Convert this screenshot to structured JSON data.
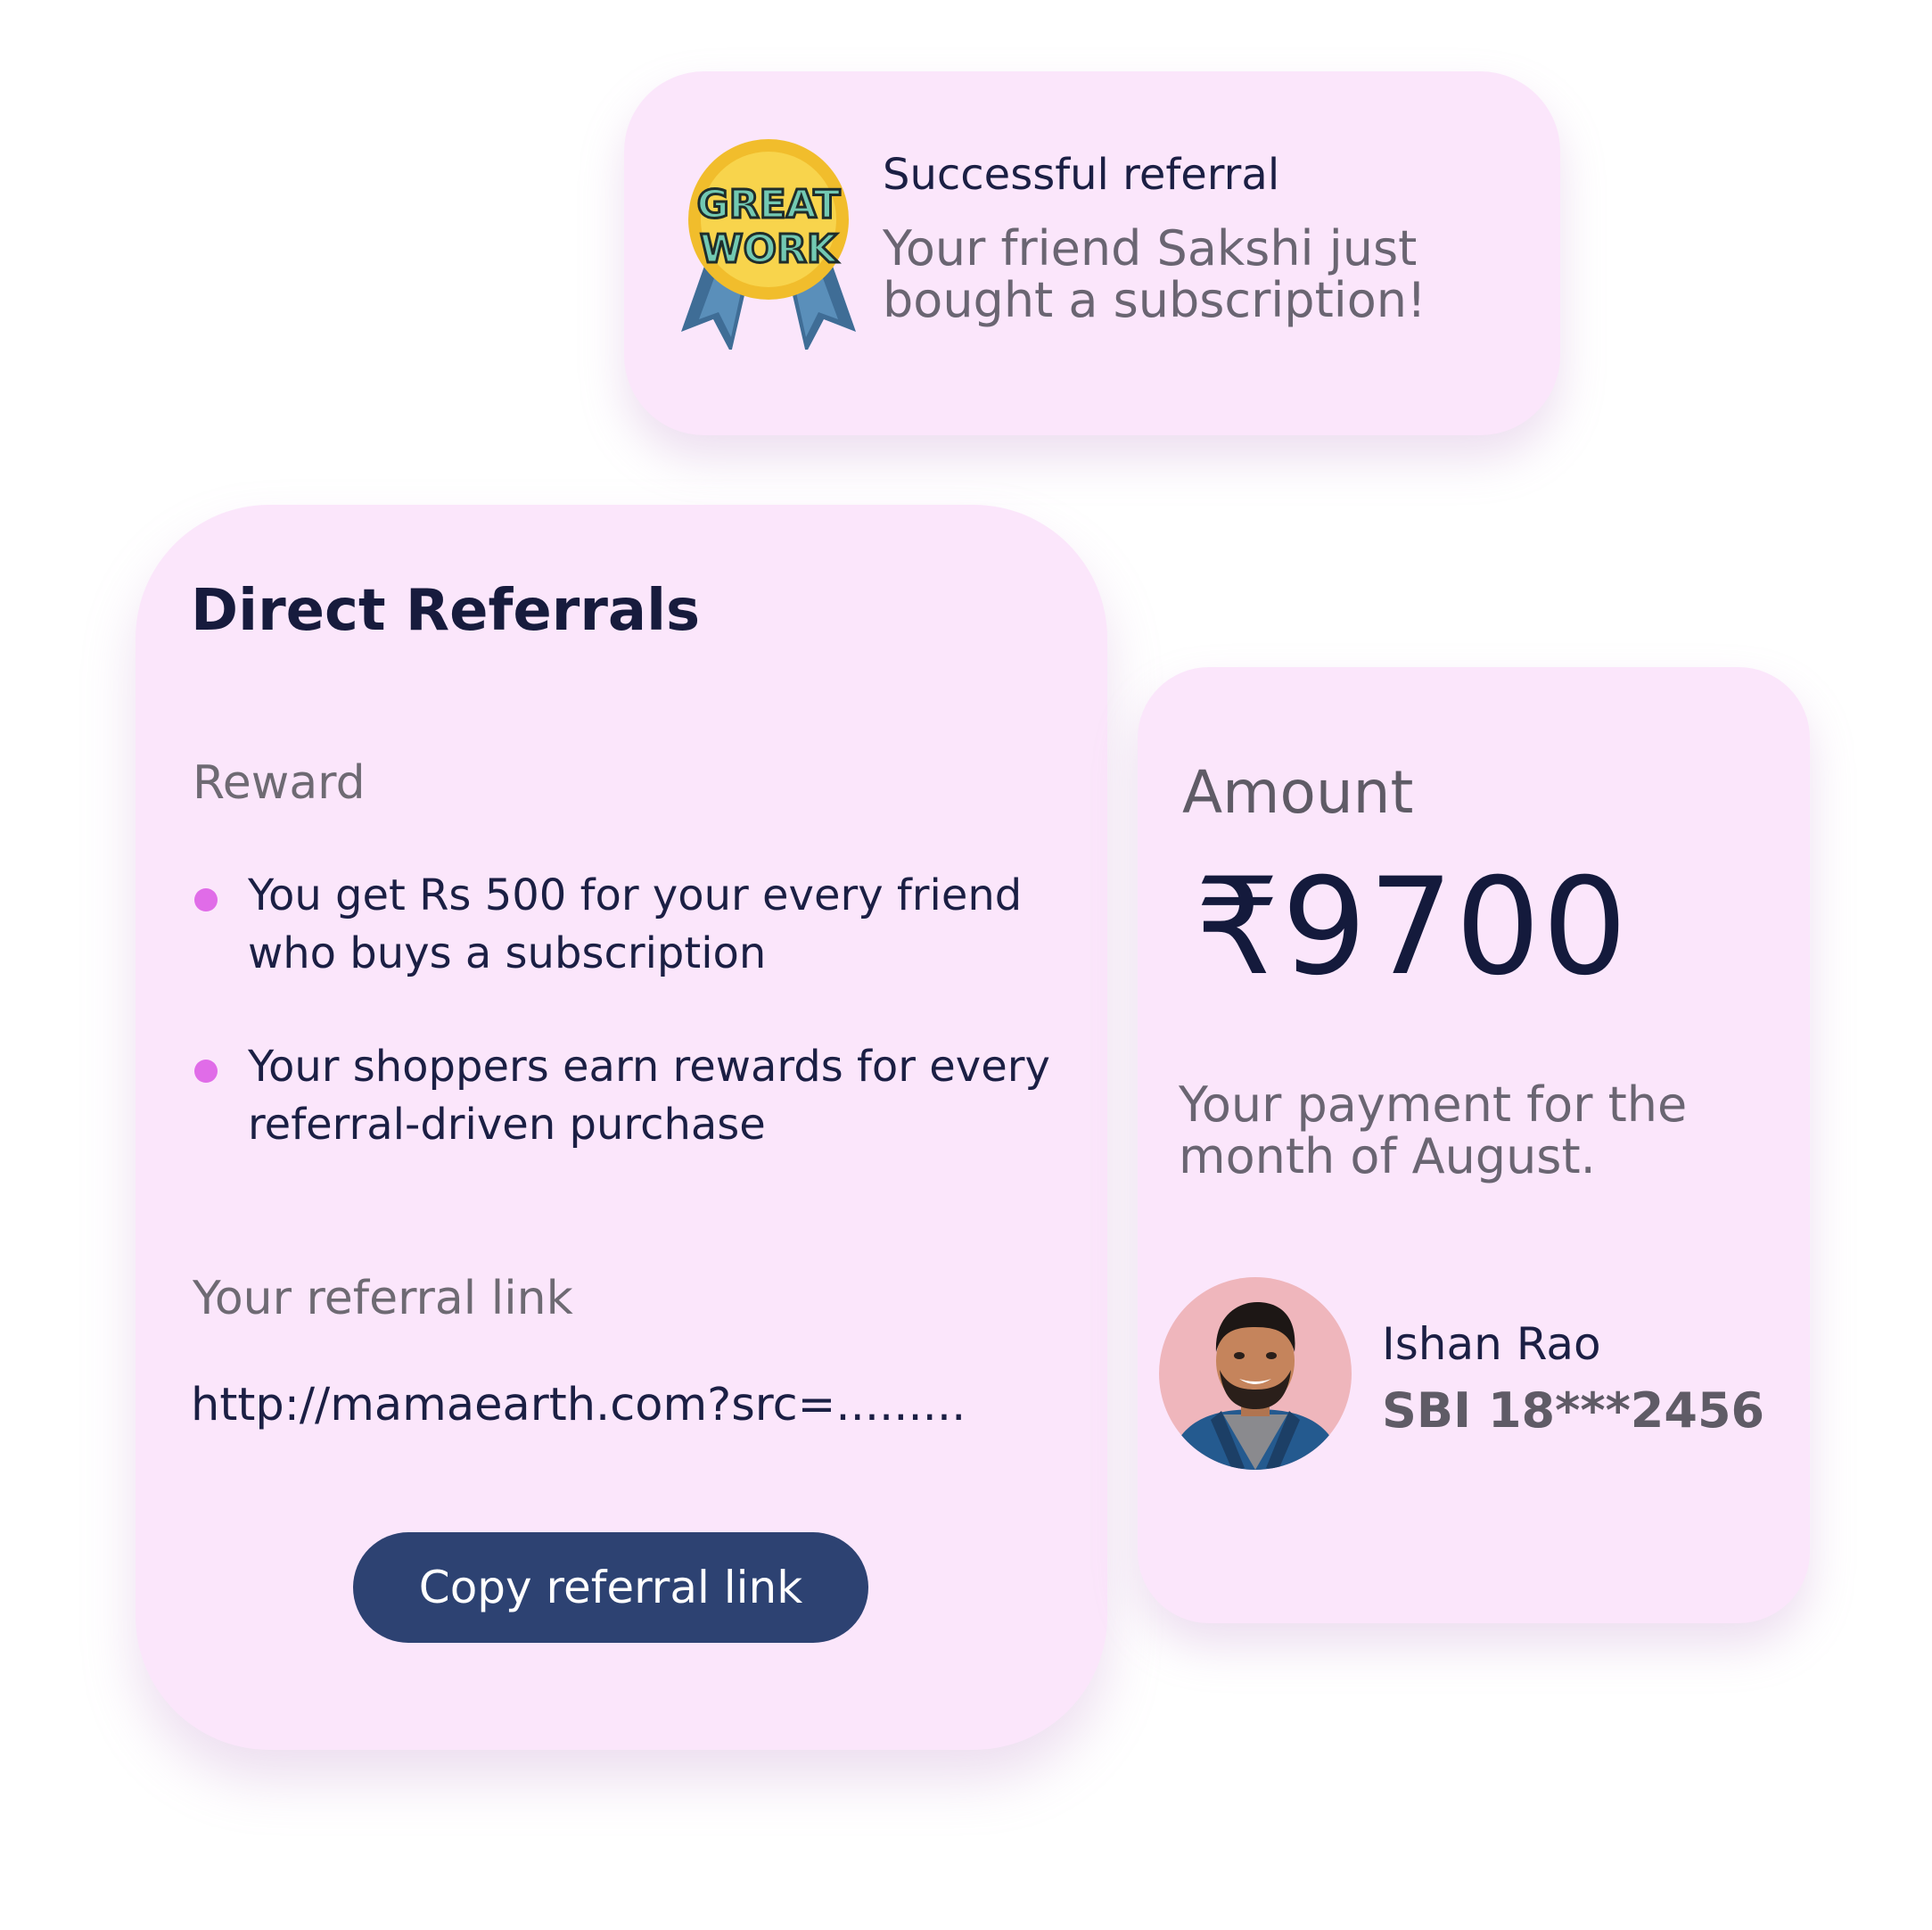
{
  "notification": {
    "badge_text_line1": "GREAT",
    "badge_text_line2": "WORK",
    "title": "Successful referral",
    "message": "Your friend Sakshi just bought a subscription!"
  },
  "referrals": {
    "title": "Direct Referrals",
    "reward_label": "Reward",
    "rewards": [
      "You get Rs 500 for your every friend who buys a subscription",
      "Your shoppers earn rewards for every referral-driven purchase"
    ],
    "link_label": "Your referral link",
    "link_value": "http://mamaearth.com?src=.........",
    "copy_button_label": "Copy referral link"
  },
  "amount": {
    "label": "Amount",
    "value": "₹9700",
    "note": "Your payment for the month of August.",
    "person_name": "Ishan Rao",
    "bank_account": "SBI 18***2456"
  },
  "icons": {
    "badge": "great-work-medal-icon",
    "bullet": "bullet-dot-icon",
    "avatar": "user-avatar"
  },
  "colors": {
    "card_background": "#fbe6fb",
    "primary_button": "#2d4272",
    "bullet_accent": "#e06ce8",
    "heading_text": "#171b3d"
  }
}
